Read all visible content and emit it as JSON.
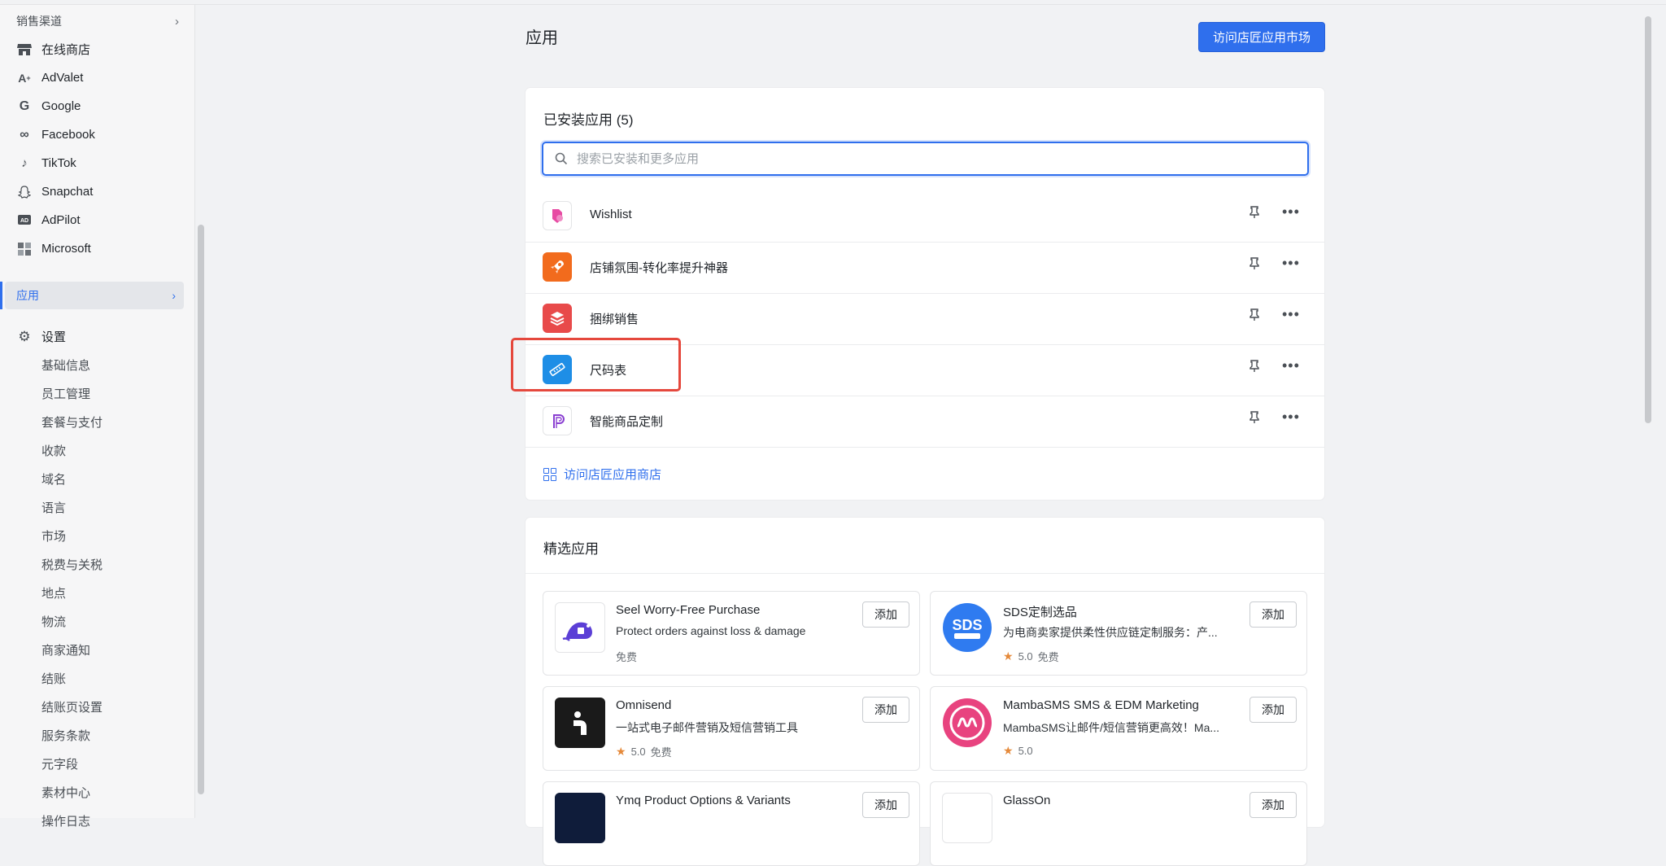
{
  "sidebar": {
    "sales_channels_label": "销售渠道",
    "channels": [
      {
        "label": "在线商店",
        "icon": "store-icon"
      },
      {
        "label": "AdValet",
        "icon": "advalet-icon"
      },
      {
        "label": "Google",
        "icon": "google-icon"
      },
      {
        "label": "Facebook",
        "icon": "meta-icon"
      },
      {
        "label": "TikTok",
        "icon": "tiktok-icon"
      },
      {
        "label": "Snapchat",
        "icon": "snapchat-icon"
      },
      {
        "label": "AdPilot",
        "icon": "adpilot-icon"
      },
      {
        "label": "Microsoft",
        "icon": "microsoft-icon"
      }
    ],
    "apps_label": "应用",
    "settings_label": "设置",
    "settings_items": [
      "基础信息",
      "员工管理",
      "套餐与支付",
      "收款",
      "域名",
      "语言",
      "市场",
      "税费与关税",
      "地点",
      "物流",
      "商家通知",
      "结账",
      "结账页设置",
      "服务条款",
      "元字段",
      "素材中心",
      "操作日志"
    ]
  },
  "header": {
    "title": "应用",
    "market_button": "访问店匠应用市场"
  },
  "installed": {
    "title": "已安装应用 (5)",
    "search_placeholder": "搜索已安装和更多应用",
    "apps": [
      {
        "name": "Wishlist",
        "icon": "heart-tag-icon"
      },
      {
        "name": "店铺氛围-转化率提升神器",
        "icon": "rocket-icon"
      },
      {
        "name": "捆绑销售",
        "icon": "layers-icon"
      },
      {
        "name": "尺码表",
        "icon": "ruler-icon"
      },
      {
        "name": "智能商品定制",
        "icon": "custom-p-icon"
      }
    ],
    "visit_link": "访问店匠应用商店"
  },
  "featured": {
    "title": "精选应用",
    "add_label": "添加",
    "apps": [
      {
        "name": "Seel Worry-Free Purchase",
        "desc": "Protect orders against loss & damage",
        "rating": "",
        "price": "免费"
      },
      {
        "name": "SDS定制选品",
        "desc": "为电商卖家提供柔性供应链定制服务：产...",
        "rating": "5.0",
        "price": "免费"
      },
      {
        "name": "Omnisend",
        "desc": "一站式电子邮件营销及短信营销工具",
        "rating": "5.0",
        "price": "免费"
      },
      {
        "name": "MambaSMS SMS & EDM Marketing",
        "desc": "MambaSMS让邮件/短信营销更高效！Ma...",
        "rating": "5.0",
        "price": ""
      },
      {
        "name": "Ymq Product Options & Variants",
        "desc": "",
        "rating": "",
        "price": ""
      },
      {
        "name": "GlassOn",
        "desc": "",
        "rating": "",
        "price": ""
      }
    ]
  },
  "colors": {
    "accent": "#2f6fed",
    "highlight": "#e5483d",
    "star": "#e5893a"
  }
}
